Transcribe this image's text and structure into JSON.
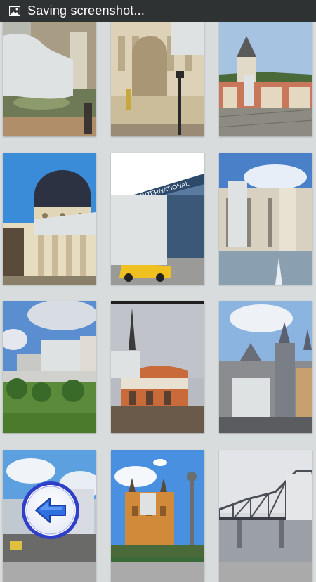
{
  "status_bar": {
    "text": "Saving screenshot...",
    "icon": "image-icon"
  },
  "gallery": {
    "tiles": [
      {
        "name": "tile-fountain-building",
        "theme": "fountain"
      },
      {
        "name": "tile-ornate-palace",
        "theme": "palace"
      },
      {
        "name": "tile-clock-tower-square",
        "theme": "tower"
      },
      {
        "name": "tile-domed-athenaeum",
        "theme": "dome"
      },
      {
        "name": "tile-hotel-yellow-taxi",
        "theme": "hotel"
      },
      {
        "name": "tile-palace-fountain",
        "theme": "palace2"
      },
      {
        "name": "tile-park-cityscape",
        "theme": "park"
      },
      {
        "name": "tile-cathedral-modern",
        "theme": "cathedral"
      },
      {
        "name": "tile-baroque-church",
        "theme": "church"
      },
      {
        "name": "tile-city-buildings",
        "theme": "city"
      },
      {
        "name": "tile-orange-cathedral",
        "theme": "orange"
      },
      {
        "name": "tile-steel-bridge",
        "theme": "bridge"
      }
    ]
  },
  "back_button": {
    "icon": "back-arrow-icon",
    "colors": {
      "ring": "#3a4fd8",
      "arrow": "#2f6fe0"
    }
  },
  "colors": {
    "status_bar": "#2f3233",
    "background": "#d9dcdc",
    "puzzle_missing": "#dfe2e2"
  }
}
